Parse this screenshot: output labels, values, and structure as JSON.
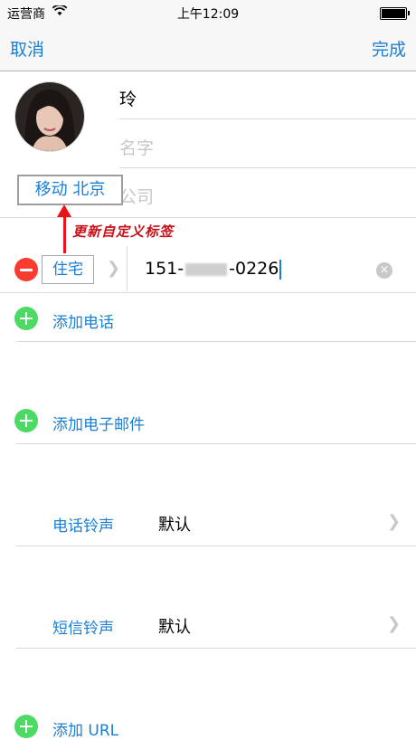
{
  "status": {
    "carrier": "运营商",
    "time": "上午12:09"
  },
  "nav": {
    "cancel": "取消",
    "done": "完成"
  },
  "contact": {
    "first_name": "玲",
    "last_name_placeholder": "名字",
    "company_placeholder": "公司"
  },
  "custom_label": "移动 北京",
  "annotation": "更新自定义标签",
  "phone": {
    "label": "住宅",
    "prefix": "151-",
    "suffix": "-0226"
  },
  "add_phone": "添加电话",
  "add_email": "添加电子邮件",
  "ringtone": {
    "label": "电话铃声",
    "value": "默认"
  },
  "text_tone": {
    "label": "短信铃声",
    "value": "默认"
  },
  "add_url": "添加 URL",
  "colors": {
    "accent": "#1a7fd4",
    "delete": "#fb3b30",
    "add": "#4cd964",
    "annotation": "#e8141a"
  }
}
